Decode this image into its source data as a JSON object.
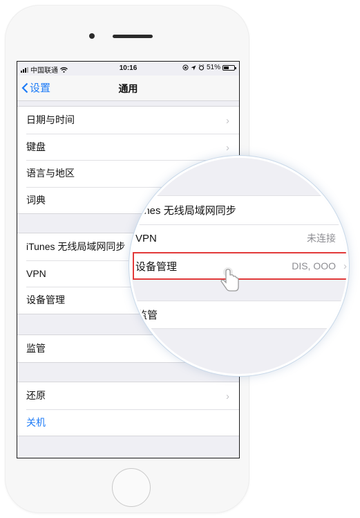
{
  "status_bar": {
    "carrier": "中国联通",
    "time": "10:16",
    "battery": "51%",
    "battery_level": 0.51
  },
  "nav": {
    "back_label": "设置",
    "title": "通用"
  },
  "group1": [
    {
      "label": "日期与时间",
      "chevron": true
    },
    {
      "label": "键盘",
      "chevron": true
    },
    {
      "label": "语言与地区",
      "chevron": false
    },
    {
      "label": "词典",
      "chevron": false
    }
  ],
  "group2": [
    {
      "label": "iTunes 无线局域网同步"
    },
    {
      "label": "VPN"
    },
    {
      "label": "设备管理"
    }
  ],
  "group3": [
    {
      "label": "监管"
    }
  ],
  "group4": [
    {
      "label": "还原",
      "chevron": true
    },
    {
      "label": "关机",
      "accent": true
    }
  ],
  "magnifier": {
    "itunes_label": "unes 无线局域网同步",
    "vpn_label": "VPN",
    "vpn_value": "未连接",
    "device_label": "设备管理",
    "device_value": "DIS, OOO",
    "supervision_label": "监管"
  },
  "colors": {
    "accent": "#1f7cf7",
    "highlight": "#e23a3a",
    "background": "#efeff4"
  }
}
